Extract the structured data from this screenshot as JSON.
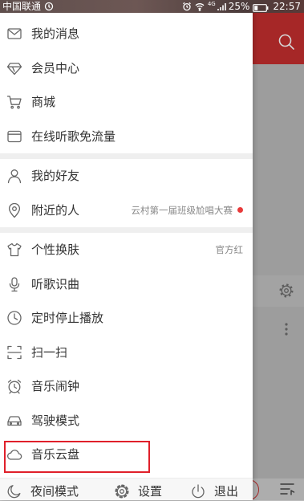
{
  "status_bar": {
    "carrier": "中国联通",
    "network": "4G",
    "battery": "25%",
    "time": "22:57",
    "icons": [
      "sync-status-icon",
      "alarm-icon",
      "wifi-icon",
      "signal-icon",
      "battery-icon"
    ]
  },
  "menu": {
    "groups": [
      {
        "items": [
          {
            "label": "我的消息",
            "icon": "envelope-icon"
          },
          {
            "label": "会员中心",
            "icon": "vip-diamond-icon"
          },
          {
            "label": "商城",
            "icon": "cart-icon"
          },
          {
            "label": "在线听歌免流量",
            "icon": "data-card-icon"
          }
        ]
      },
      {
        "items": [
          {
            "label": "我的好友",
            "icon": "person-icon"
          },
          {
            "label": "附近的人",
            "icon": "location-pin-icon",
            "extra": "云村第一届班级尬唱大赛",
            "badge_dot": true
          }
        ]
      },
      {
        "items": [
          {
            "label": "个性换肤",
            "icon": "tshirt-icon",
            "extra": "官方红"
          },
          {
            "label": "听歌识曲",
            "icon": "microphone-icon"
          },
          {
            "label": "定时停止播放",
            "icon": "clock-icon"
          },
          {
            "label": "扫一扫",
            "icon": "scan-icon"
          },
          {
            "label": "音乐闹钟",
            "icon": "alarm-clock-icon"
          },
          {
            "label": "驾驶模式",
            "icon": "car-icon"
          },
          {
            "label": "音乐云盘",
            "icon": "cloud-icon",
            "highlighted": true
          }
        ]
      }
    ]
  },
  "footer": [
    {
      "label": "夜间模式",
      "icon": "moon-icon"
    },
    {
      "label": "设置",
      "icon": "gear-icon"
    },
    {
      "label": "退出",
      "icon": "power-icon"
    }
  ],
  "background_app": {
    "header_icon": "search-icon",
    "row_icons": [
      "gear-icon",
      "more-vertical-icon"
    ],
    "player_icons": [
      "play-circle-icon",
      "playlist-icon"
    ]
  },
  "colors": {
    "accent_red": "#c62f2f",
    "highlight_border": "#e0202a",
    "badge_dot": "#e83a3a",
    "text_primary": "#333333",
    "text_secondary": "#888888",
    "icon_stroke": "#666666"
  }
}
